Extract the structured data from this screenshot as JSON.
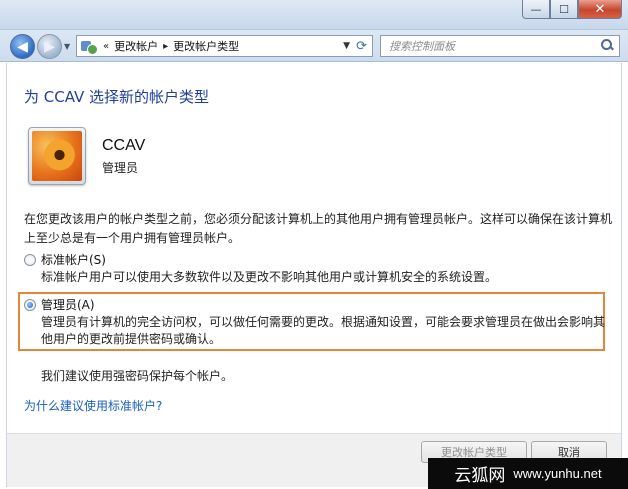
{
  "window": {
    "min_glyph": "—",
    "max_glyph": "☐",
    "close_glyph": "✕"
  },
  "address": {
    "chevron_left": "«",
    "segments": [
      "更改帐户",
      "更改帐户类型"
    ],
    "separator": "▸",
    "search_placeholder": "搜索控制面板"
  },
  "page": {
    "title": "为 CCAV 选择新的帐户类型",
    "user_name": "CCAV",
    "user_role": "管理员",
    "explanation": "在您更改该用户的帐户类型之前，您必须分配该计算机上的其他用户拥有管理员帐户。这样可以确保在该计算机上至少总是有一个用户拥有管理员帐户。",
    "options": [
      {
        "label": "标准帐户(S)",
        "description": "标准帐户用户可以使用大多数软件以及更改不影响其他用户或计算机安全的系统设置。",
        "selected": false
      },
      {
        "label": "管理员(A)",
        "description": "管理员有计算机的完全访问权，可以做任何需要的更改。根据通知设置，可能会要求管理员在做出会影响其他用户的更改前提供密码或确认。",
        "selected": true
      }
    ],
    "recommendation": "我们建议使用强密码保护每个帐户。",
    "help_link": "为什么建议使用标准帐户?"
  },
  "buttons": {
    "change": "更改帐户类型",
    "cancel": "取消"
  },
  "watermark": {
    "chinese": "云狐网",
    "url": "www.yunhu.net"
  },
  "colors": {
    "title_blue": "#1f3f9b",
    "link_blue": "#1a5fbf",
    "highlight_orange": "#e0883a"
  },
  "icons": {
    "back": "arrow-left-icon",
    "forward": "arrow-right-icon",
    "refresh": "refresh-icon",
    "search": "search-icon",
    "address": "control-panel-icon"
  }
}
